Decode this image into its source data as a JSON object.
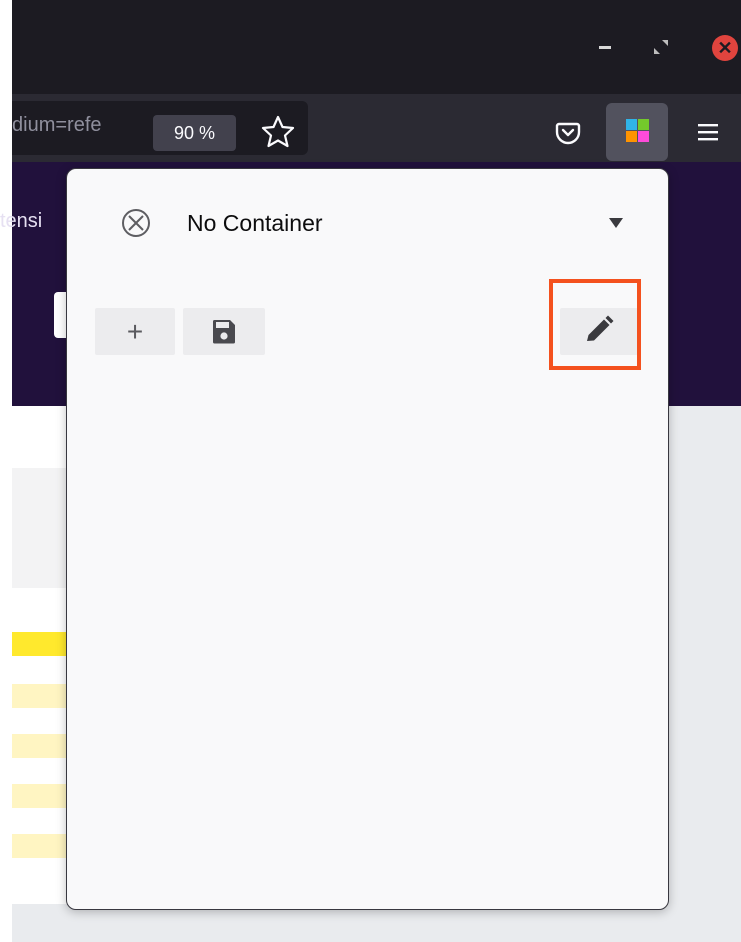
{
  "browser": {
    "url_fragment": "dium=refe",
    "zoom": "90 %",
    "window_controls": {
      "minimize_icon": "minimize-icon",
      "restore_icon": "restore-icon",
      "close_icon": "close-icon",
      "close_color": "#e0443e"
    }
  },
  "page_background": {
    "partial_text": "tensi",
    "header_color": "#21113c"
  },
  "popup": {
    "container_label": "No Container",
    "container_icon": "no-container-icon",
    "dropdown_icon": "chevron-down-icon",
    "add_label": "+",
    "save_icon": "save-icon",
    "edit_icon": "pencil-icon",
    "highlight_color": "#f4511e"
  },
  "extension_icon": {
    "colors": [
      "#30b4e8",
      "#74c92b",
      "#ff9400",
      "#ff4bda"
    ]
  }
}
